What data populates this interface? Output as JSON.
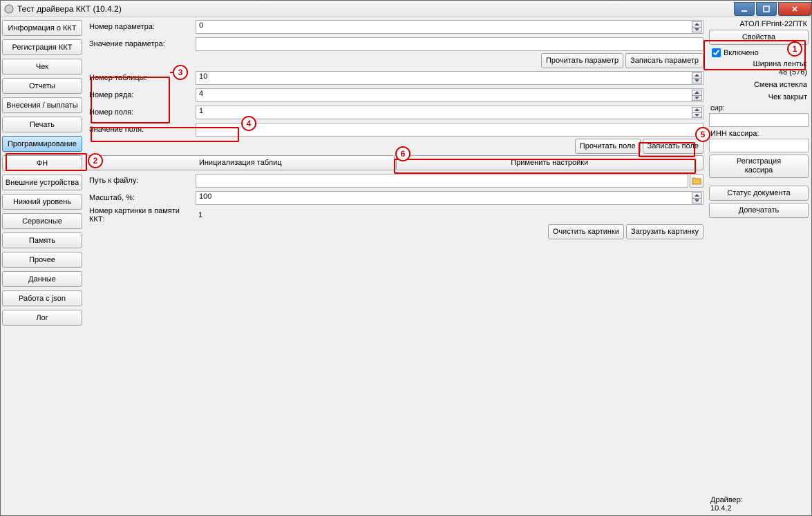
{
  "title": "Тест драйвера ККТ (10.4.2)",
  "sidebar": {
    "items": [
      "Информация о ККТ",
      "Регистрация ККТ",
      "Чек",
      "Отчеты",
      "Внесения / выплаты",
      "Печать",
      "Программирование",
      "ФН",
      "Внешние устройства",
      "Нижний уровень",
      "Сервисные",
      "Память",
      "Прочее",
      "Данные",
      "Работа с json",
      "Лог"
    ],
    "active_index": 6
  },
  "center": {
    "param_number_label": "Номер параметра:",
    "param_number_value": "0",
    "param_value_label": "Значение параметра:",
    "param_value_value": "",
    "btn_read_param": "Прочитать параметр",
    "btn_write_param": "Записать параметр",
    "table_number_label": "Номер таблицы:",
    "table_number_value": "10",
    "row_number_label": "Номер ряда:",
    "row_number_value": "4",
    "field_number_label": "Номер поля:",
    "field_number_value": "1",
    "field_value_label": "Значение поля:",
    "field_value_value": "",
    "btn_read_field": "Прочитать поле",
    "btn_write_field": "Записать поле",
    "btn_init_tables": "Инициализация таблиц",
    "btn_apply_settings": "Применить настройки",
    "path_label": "Путь к файлу:",
    "path_value": "",
    "scale_label": "Масштаб, %:",
    "scale_value": "100",
    "img_num_label": "Номер картинки в памяти ККТ:",
    "img_num_value": "1",
    "btn_clear_images": "Очистить картинки",
    "btn_load_image": "Загрузить картинку"
  },
  "right": {
    "device_name": "АТОЛ FPrint-22ПТК",
    "btn_props": "Свойства",
    "chk_enabled_label": "Включено",
    "chk_enabled_checked": true,
    "ribbon_width_label": "Ширина ленты:",
    "ribbon_width_value": "48 (576)",
    "shift_status": "Смена истекла",
    "receipt_status": "Чек закрыт",
    "cashier_label": "сир:",
    "cashier_value": "",
    "inn_label": "ИНН кассира:",
    "inn_value": "",
    "btn_register_cashier_l1": "Регистрация",
    "btn_register_cashier_l2": "кассира",
    "btn_doc_status": "Статус документа",
    "btn_reprint": "Допечатать",
    "driver_label": "Драйвер:",
    "driver_version": "10.4.2"
  },
  "callouts": [
    "1",
    "2",
    "3",
    "4",
    "5",
    "6"
  ]
}
